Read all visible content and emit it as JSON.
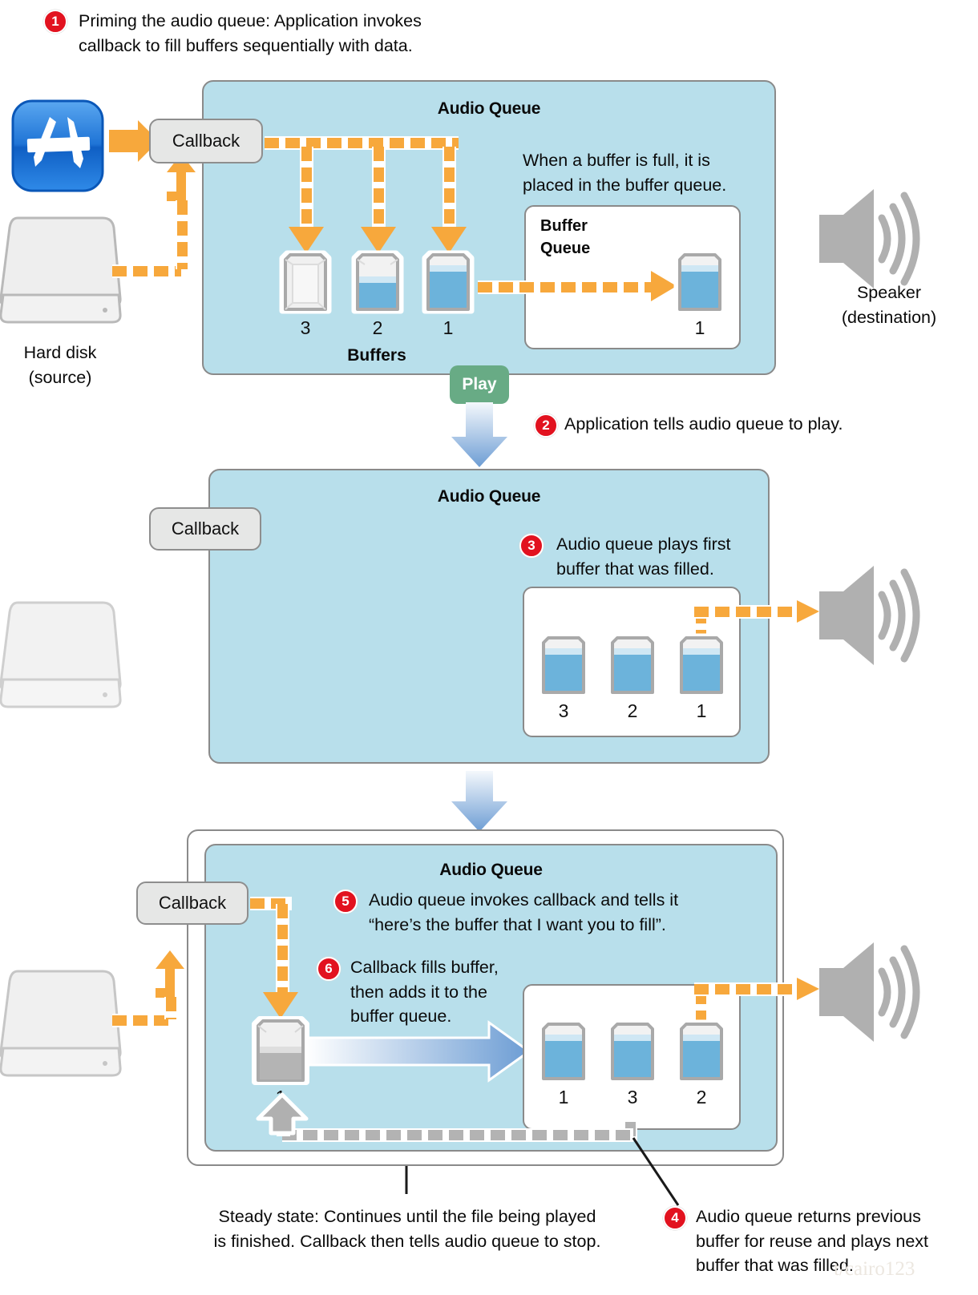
{
  "meta": {
    "colors": {
      "panel_bg": "#b8dfeb",
      "panel_border": "#8a8a8a",
      "orange": "#f7a83c",
      "red_badge": "#e2121f",
      "green_play": "#68ab85",
      "buffer_fill": "#6cb3db",
      "gray_dash": "#b3b3b3",
      "blue_arrow": "#7aa6d6",
      "app_icon_blue": "#1b6fd4"
    }
  },
  "steps": {
    "one": {
      "number": "1",
      "text": "Priming the audio queue: Application invokes\ncallback to fill buffers sequentially with data."
    },
    "two": {
      "number": "2",
      "text": "Application tells audio queue to play."
    },
    "three": {
      "number": "3",
      "text": "Audio queue plays first\nbuffer that was filled."
    },
    "four": {
      "number": "4",
      "text": "Audio queue returns previous\nbuffer for reuse and plays next\nbuffer that was filled."
    },
    "five": {
      "number": "5",
      "text": "Audio queue invokes callback and tells it\n“here’s the buffer that I want you to fill”."
    },
    "six": {
      "number": "6",
      "text": "Callback fills buffer,\nthen adds it to the\nbuffer queue."
    }
  },
  "sources": {
    "hard_disk_label": "Hard disk\n(source)",
    "speaker_label": "Speaker\n(destination)"
  },
  "panel1": {
    "title": "Audio Queue",
    "callback_label": "Callback",
    "note": "When a buffer is full, it is\nplaced in the buffer queue.",
    "buffer_queue_label": "Buffer\nQueue",
    "buffers_label": "Buffers",
    "buffers": [
      {
        "number": "3",
        "fill": 0
      },
      {
        "number": "2",
        "fill": 45
      },
      {
        "number": "1",
        "fill": 100
      }
    ],
    "queued_buffers": [
      {
        "number": "1",
        "fill": 100
      }
    ],
    "play_label": "Play"
  },
  "panel2": {
    "title": "Audio Queue",
    "callback_label": "Callback",
    "queued_buffers": [
      {
        "number": "3",
        "fill": 100
      },
      {
        "number": "2",
        "fill": 100
      },
      {
        "number": "1",
        "fill": 100
      }
    ]
  },
  "panel3": {
    "title": "Audio Queue",
    "callback_label": "Callback",
    "refill_buffer": {
      "number": "1",
      "fill": 55,
      "gray": true
    },
    "queued_buffers": [
      {
        "number": "1",
        "fill": 100
      },
      {
        "number": "3",
        "fill": 100
      },
      {
        "number": "2",
        "fill": 100
      }
    ],
    "steady_state_caption": "Steady state: Continues until the file being played\nis finished. Callback then tells audio queue to stop."
  },
  "watermark": "t/cairo123"
}
